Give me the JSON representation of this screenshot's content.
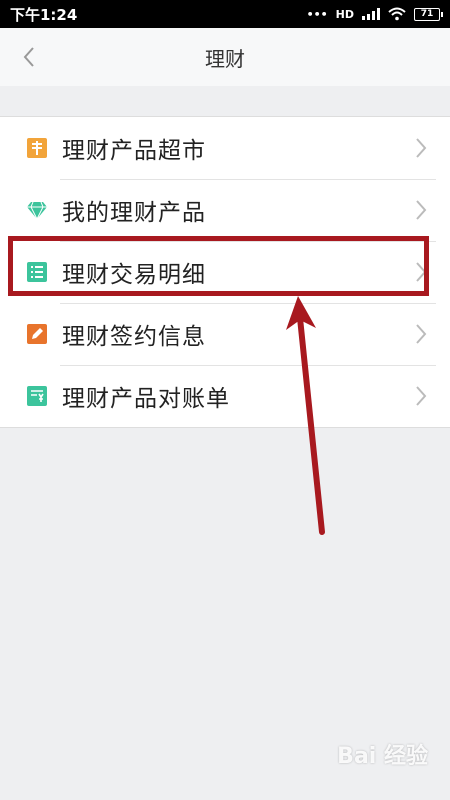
{
  "status_bar": {
    "time": "下午1:24",
    "hd_label": "HD",
    "battery": "71"
  },
  "nav": {
    "title": "理财"
  },
  "menu": {
    "items": [
      {
        "label": "理财产品超市",
        "icon": "market-icon",
        "icon_color": "#f2a43a"
      },
      {
        "label": "我的理财产品",
        "icon": "diamond-icon",
        "icon_color": "#3cc49c"
      },
      {
        "label": "理财交易明细",
        "icon": "list-detail-icon",
        "icon_color": "#3cc49c"
      },
      {
        "label": "理财签约信息",
        "icon": "edit-icon",
        "icon_color": "#e8742c"
      },
      {
        "label": "理财产品对账单",
        "icon": "statement-icon",
        "icon_color": "#3cc49c"
      }
    ]
  },
  "annotation": {
    "color": "#a8191f"
  },
  "watermark": {
    "text": "Bai 经验"
  }
}
